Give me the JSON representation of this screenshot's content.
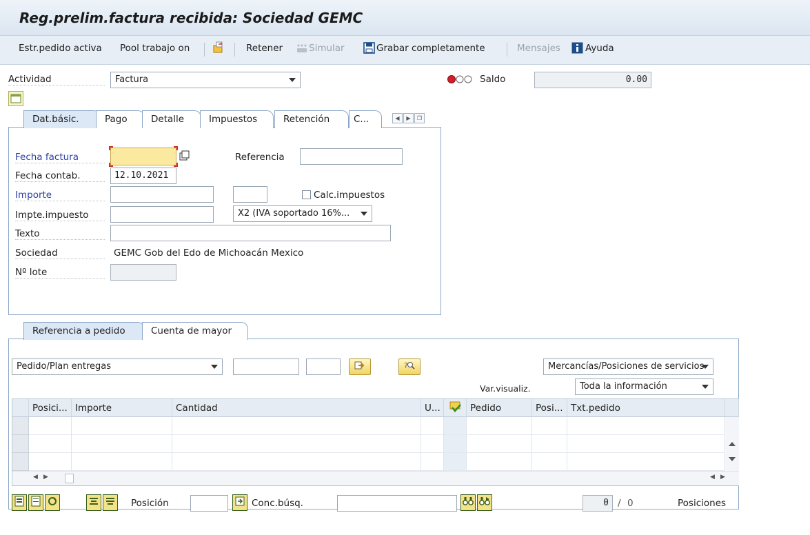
{
  "window": {
    "title": "Reg.prelim.factura recibida: Sociedad GEMC"
  },
  "toolbar": {
    "items": [
      {
        "label": "Estr.pedido activa"
      },
      {
        "label": "Pool trabajo on"
      },
      {
        "label": "Retener"
      },
      {
        "label": "Simular"
      },
      {
        "label": "Grabar completamente"
      },
      {
        "label": "Mensajes"
      },
      {
        "label": "Ayuda"
      }
    ]
  },
  "header": {
    "actividad_label": "Actividad",
    "actividad_value": "Factura",
    "saldo_label": "Saldo",
    "saldo_value": "0.00"
  },
  "tabs_top": [
    {
      "label": "Dat.básic."
    },
    {
      "label": "Pago"
    },
    {
      "label": "Detalle"
    },
    {
      "label": "Impuestos"
    },
    {
      "label": "Retención"
    },
    {
      "label": "C..."
    }
  ],
  "basic": {
    "fecha_factura_label": "Fecha factura",
    "fecha_factura_value": "",
    "referencia_label": "Referencia",
    "referencia_value": "",
    "fecha_contab_label": "Fecha contab.",
    "fecha_contab_value": "12.10.2021",
    "importe_label": "Importe",
    "importe_value": "",
    "moneda_value": "",
    "calc_impuestos_label": "Calc.impuestos",
    "impte_impuesto_label": "Impte.impuesto",
    "impte_impuesto_value": "",
    "indicador_value": "X2 (IVA soportado 16%...",
    "texto_label": "Texto",
    "texto_value": "",
    "sociedad_label": "Sociedad",
    "sociedad_value": "GEMC Gob del Edo de Michoacán Mexico",
    "lote_label": "Nº lote",
    "lote_value": ""
  },
  "tabs_bottom": [
    {
      "label": "Referencia a pedido"
    },
    {
      "label": "Cuenta de mayor"
    }
  ],
  "order": {
    "ref_type": "Pedido/Plan entregas",
    "field1": "",
    "field2": "",
    "goods_type": "Mercancías/Posiciones de servicios",
    "var_label": "Var.visualiz.",
    "var_value": "Toda la información"
  },
  "grid": {
    "columns": [
      "Posici...",
      "Importe",
      "Cantidad",
      "U...",
      "",
      "Pedido",
      "Posi...",
      "Txt.pedido"
    ],
    "rows": 3
  },
  "footer": {
    "posicion_label": "Posición",
    "posicion_value": "",
    "conc_label": "Conc.búsq.",
    "conc_value": "",
    "count_value": "0",
    "count_sep": "/",
    "count_total": "0",
    "posiciones_label": "Posiciones"
  },
  "colors": {
    "accent": "#2a3fa5",
    "required_field": "#fbe9a0",
    "status_red": "#d21f2b"
  }
}
